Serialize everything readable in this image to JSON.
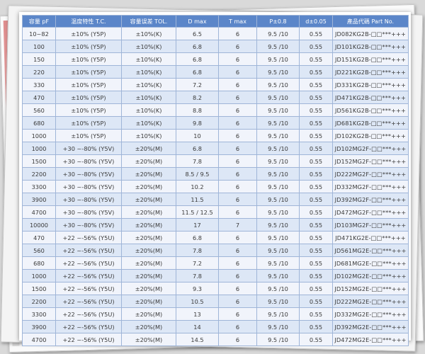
{
  "table": {
    "headers": [
      "容量 pF",
      "温度特性 T.C.",
      "容量误差 TOL.",
      "D max",
      "T max",
      "P±0.8",
      "d±0.05",
      "產品代碼 Part No."
    ],
    "rows": [
      [
        "10~82",
        "±10% (Y5P)",
        "±10%(K)",
        "6.5",
        "6",
        "9.5 /10",
        "0.55",
        "JD082KG2B-□□***+++"
      ],
      [
        "100",
        "±10% (Y5P)",
        "±10%(K)",
        "6.8",
        "6",
        "9.5 /10",
        "0.55",
        "JD101KG2B-□□***+++"
      ],
      [
        "150",
        "±10% (Y5P)",
        "±10%(K)",
        "6.8",
        "6",
        "9.5 /10",
        "0.55",
        "JD151KG2B-□□***+++"
      ],
      [
        "220",
        "±10% (Y5P)",
        "±10%(K)",
        "6.8",
        "6",
        "9.5 /10",
        "0.55",
        "JD221KG2B-□□***+++"
      ],
      [
        "330",
        "±10% (Y5P)",
        "±10%(K)",
        "7.2",
        "6",
        "9.5 /10",
        "0.55",
        "JD331KG2B-□□***+++"
      ],
      [
        "470",
        "±10% (Y5P)",
        "±10%(K)",
        "8.2",
        "6",
        "9.5 /10",
        "0.55",
        "JD471KG2B-□□***+++"
      ],
      [
        "560",
        "±10% (Y5P)",
        "±10%(K)",
        "8.8",
        "6",
        "9.5 /10",
        "0.55",
        "JD561KG2B-□□***+++"
      ],
      [
        "680",
        "±10% (Y5P)",
        "±10%(K)",
        "9.8",
        "6",
        "9.5 /10",
        "0.55",
        "JD681KG2B-□□***+++"
      ],
      [
        "1000",
        "±10% (Y5P)",
        "±10%(K)",
        "10",
        "6",
        "9.5 /10",
        "0.55",
        "JD102KG2B-□□***+++"
      ],
      [
        "1000",
        "+30 ~-80% (Y5V)",
        "±20%(M)",
        "6.8",
        "6",
        "9.5 /10",
        "0.55",
        "JD102MG2F-□□***+++"
      ],
      [
        "1500",
        "+30 ~-80% (Y5V)",
        "±20%(M)",
        "7.8",
        "6",
        "9.5 /10",
        "0.55",
        "JD152MG2F-□□***+++"
      ],
      [
        "2200",
        "+30 ~-80% (Y5V)",
        "±20%(M)",
        "8.5 / 9.5",
        "6",
        "9.5 /10",
        "0.55",
        "JD222MG2F-□□***+++"
      ],
      [
        "3300",
        "+30 ~-80% (Y5V)",
        "±20%(M)",
        "10.2",
        "6",
        "9.5 /10",
        "0.55",
        "JD332MG2F-□□***+++"
      ],
      [
        "3900",
        "+30 ~-80% (Y5V)",
        "±20%(M)",
        "11.5",
        "6",
        "9.5 /10",
        "0.55",
        "JD392MG2F-□□***+++"
      ],
      [
        "4700",
        "+30 ~-80% (Y5V)",
        "±20%(M)",
        "11.5 / 12.5",
        "6",
        "9.5 /10",
        "0.55",
        "JD472MG2F-□□***+++"
      ],
      [
        "10000",
        "+30 ~-80% (Y5V)",
        "±20%(M)",
        "17",
        "7",
        "9.5 /10",
        "0.55",
        "JD103MG2F-□□***+++"
      ],
      [
        "470",
        "+22 ~-56% (Y5U)",
        "±20%(M)",
        "6.8",
        "6",
        "9.5 /10",
        "0.55",
        "JD471KG2E-□□***+++"
      ],
      [
        "560",
        "+22 ~-56% (Y5U)",
        "±20%(M)",
        "7.8",
        "6",
        "9.5 /10",
        "0.55",
        "JD561MG2E-□□***+++"
      ],
      [
        "680",
        "+22 ~-56% (Y5U)",
        "±20%(M)",
        "7.2",
        "6",
        "9.5 /10",
        "0.55",
        "JD681MG2E-□□***+++"
      ],
      [
        "1000",
        "+22 ~-56% (Y5U)",
        "±20%(M)",
        "7.8",
        "6",
        "9.5 /10",
        "0.55",
        "JD102MG2E-□□***+++"
      ],
      [
        "1500",
        "+22 ~-56% (Y5U)",
        "±20%(M)",
        "9.3",
        "6",
        "9.5 /10",
        "0.55",
        "JD152MG2E-□□***+++"
      ],
      [
        "2200",
        "+22 ~-56% (Y5U)",
        "±20%(M)",
        "10.5",
        "6",
        "9.5 /10",
        "0.55",
        "JD222MG2E-□□***+++"
      ],
      [
        "3300",
        "+22 ~-56% (Y5U)",
        "±20%(M)",
        "13",
        "6",
        "9.5 /10",
        "0.55",
        "JD332MG2E-□□***+++"
      ],
      [
        "3900",
        "+22 ~-56% (Y5U)",
        "±20%(M)",
        "14",
        "6",
        "9.5 /10",
        "0.55",
        "JD392MG2E-□□***+++"
      ],
      [
        "4700",
        "+22 ~-56% (Y5U)",
        "±20%(M)",
        "14.5",
        "6",
        "9.5 /10",
        "0.55",
        "JD472MG2E-□□***+++"
      ]
    ]
  },
  "colors": {
    "header_bg": "#5b86c9",
    "row_light": "#f1f4fb",
    "row_dark": "#dde7f6",
    "border": "#9fb5d8"
  }
}
